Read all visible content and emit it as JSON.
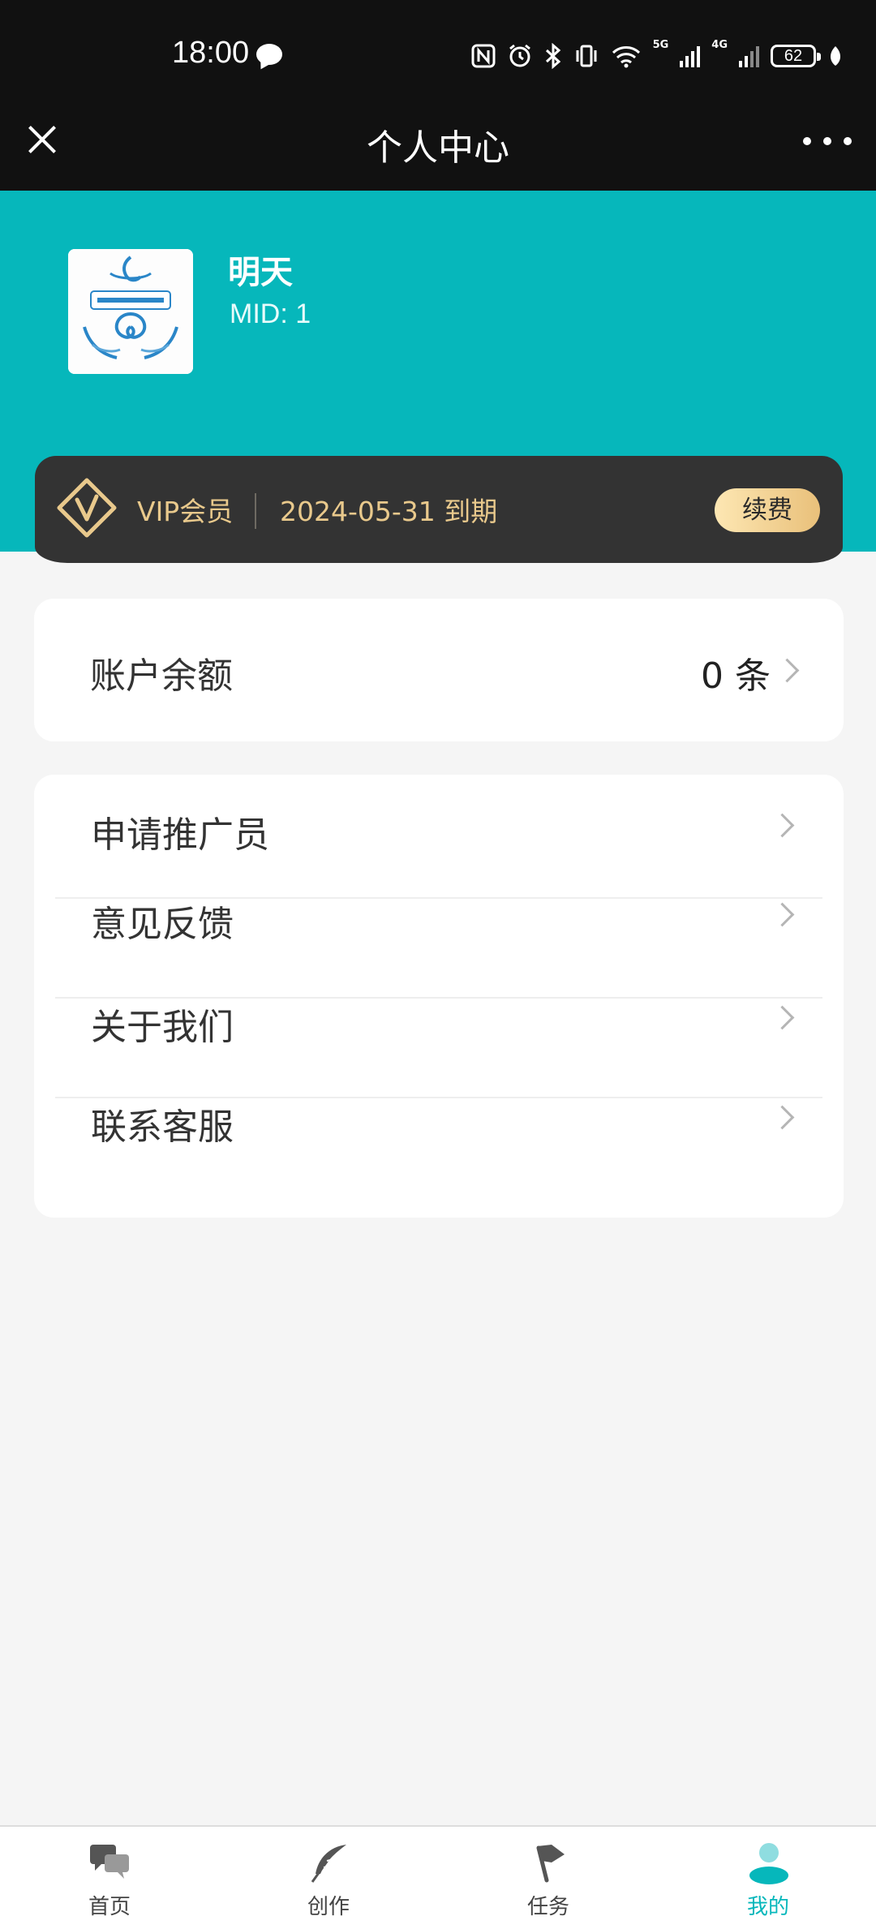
{
  "status_bar": {
    "time": "18:00",
    "battery": "62",
    "network_5g": "5G",
    "network_4g": "4G"
  },
  "header": {
    "title": "个人中心"
  },
  "profile": {
    "name": "明天",
    "mid": "MID: 1"
  },
  "vip": {
    "label": "VIP会员",
    "expiry": "2024-05-31 到期",
    "renew": "续费",
    "accent": "#e9c98c"
  },
  "balance": {
    "label": "账户余额",
    "value": "0 条"
  },
  "menu": [
    {
      "label": "申请推广员"
    },
    {
      "label": "意见反馈"
    },
    {
      "label": "关于我们"
    },
    {
      "label": "联系客服"
    }
  ],
  "tabs": [
    {
      "label": "首页",
      "icon": "chat-bubbles-icon"
    },
    {
      "label": "创作",
      "icon": "feather-icon"
    },
    {
      "label": "任务",
      "icon": "flag-icon"
    },
    {
      "label": "我的",
      "icon": "user-icon"
    }
  ],
  "colors": {
    "brand": "#06b7bb",
    "topbar": "#111111",
    "vip_card": "#333333"
  }
}
